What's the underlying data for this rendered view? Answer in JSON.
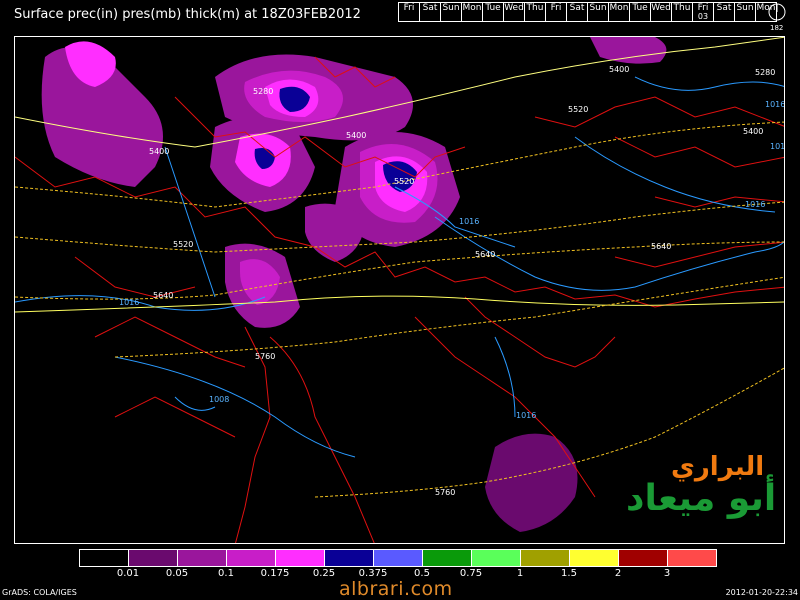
{
  "title": "Surface prec(in) pres(mb) thick(m) at 18Z03FEB2012",
  "day_bar": {
    "days": [
      "Fri",
      "Sat",
      "Sun",
      "Mon",
      "Tue",
      "Wed",
      "Thu",
      "Fri",
      "Sat",
      "Sun",
      "Mon",
      "Tue",
      "Wed",
      "Thu",
      "Fri",
      "Sat",
      "Sun",
      "Mon"
    ],
    "active_index": 14,
    "active_sub": "03"
  },
  "dial_label": "182",
  "legend": {
    "colors": [
      "#000000",
      "#6a0a6e",
      "#9a169c",
      "#c81ec8",
      "#ff2eff",
      "#0a0096",
      "#5a5aff",
      "#0a9a0a",
      "#5aff5a",
      "#a0a000",
      "#ffff30",
      "#a00000",
      "#ff4a4a"
    ],
    "labels": [
      "0.01",
      "0.05",
      "0.1",
      "0.175",
      "0.25",
      "0.375",
      "0.5",
      "0.75",
      "1",
      "1.5",
      "2",
      "3"
    ]
  },
  "footer": {
    "left": "GrADS: COLA/IGES",
    "right": "2012-01-20-22:34"
  },
  "site": "albrari.com",
  "brand": {
    "line1": "البراري",
    "line2": "أبو ميعاد"
  },
  "contour_labels": [
    "5400",
    "5280",
    "5400",
    "5520",
    "5520",
    "5400",
    "5280",
    "5640",
    "1016",
    "1016",
    "5520",
    "5640",
    "5640",
    "1016",
    "1016",
    "5760",
    "1008",
    "1016",
    "5760",
    "1016",
    "5400"
  ]
}
